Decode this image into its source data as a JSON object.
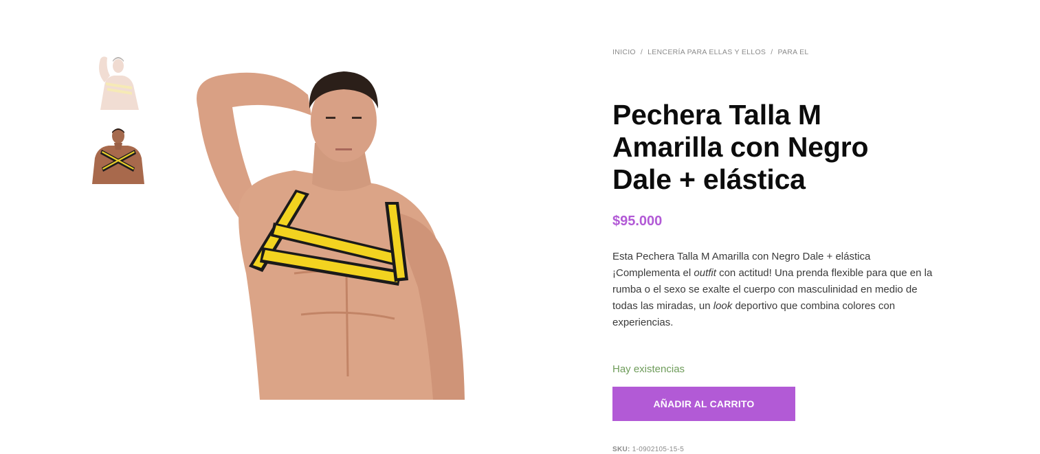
{
  "gallery": {
    "thumbnails": [
      {
        "name": "front-view",
        "active": false
      },
      {
        "name": "back-view",
        "active": true
      }
    ],
    "main_image": "model-front-wearing-harness"
  },
  "breadcrumb": {
    "items": [
      "INICIO",
      "LENCERÍA PARA ELLAS Y ELLOS",
      "PARA EL"
    ],
    "separator": "/"
  },
  "product": {
    "title": "Pechera Talla M Amarilla con Negro Dale + elástica",
    "price": "$95.000",
    "description": {
      "part1": "Esta Pechera Talla M Amarilla con Negro Dale + elástica ¡Complementa el ",
      "em1": "outfit",
      "part2": " con actitud! Una prenda flexible para que en la rumba o el sexo se exalte el cuerpo con masculinidad en medio de todas las miradas, un ",
      "em2": "look",
      "part3": " deportivo que combina colores con experiencias."
    },
    "stock": "Hay existencias",
    "add_to_cart": "AÑADIR AL CARRITO",
    "sku_label": "SKU:",
    "sku_value": "1-0902105-15-5"
  },
  "colors": {
    "accent": "#b25ad6",
    "stock": "#6e9c5a",
    "harness_yellow": "#f2d320",
    "harness_black": "#1a1a1a"
  }
}
